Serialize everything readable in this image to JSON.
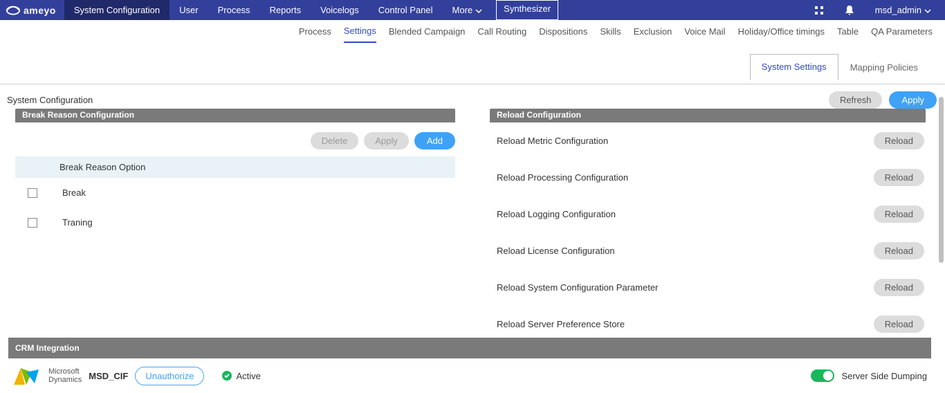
{
  "brand": "ameyo",
  "nav": {
    "items": [
      "System Configuration",
      "User",
      "Process",
      "Reports",
      "Voicelogs",
      "Control Panel",
      "More"
    ],
    "active": 0,
    "synth": "Synthesizer",
    "user": "msd_admin"
  },
  "subnav": {
    "items": [
      "Process",
      "Settings",
      "Blended Campaign",
      "Call Routing",
      "Dispositions",
      "Skills",
      "Exclusion",
      "Voice Mail",
      "Holiday/Office timings",
      "Table",
      "QA Parameters"
    ],
    "active": 1
  },
  "tabs": {
    "items": [
      "System Settings",
      "Mapping Policies"
    ],
    "active": 0
  },
  "page": {
    "title": "System Configuration",
    "refresh": "Refresh",
    "apply": "Apply"
  },
  "breakPanel": {
    "title": "Break Reason Configuration",
    "delete": "Delete",
    "apply": "Apply",
    "add": "Add",
    "column": "Break Reason Option",
    "rows": [
      "Break",
      "Traning"
    ]
  },
  "reloadPanel": {
    "title": "Reload Configuration",
    "btn": "Reload",
    "rows": [
      "Reload Metric Configuration",
      "Reload Processing Configuration",
      "Reload Logging Configuration",
      "Reload License Configuration",
      "Reload System Configuration Parameter",
      "Reload Server Preference Store"
    ]
  },
  "crm": {
    "title": "CRM Integration",
    "product_line1": "Microsoft",
    "product_line2": "Dynamics",
    "name": "MSD_CIF",
    "unauthorize": "Unauthorize",
    "status": "Active",
    "toggle_label": "Server Side Dumping",
    "toggle_on": true
  }
}
